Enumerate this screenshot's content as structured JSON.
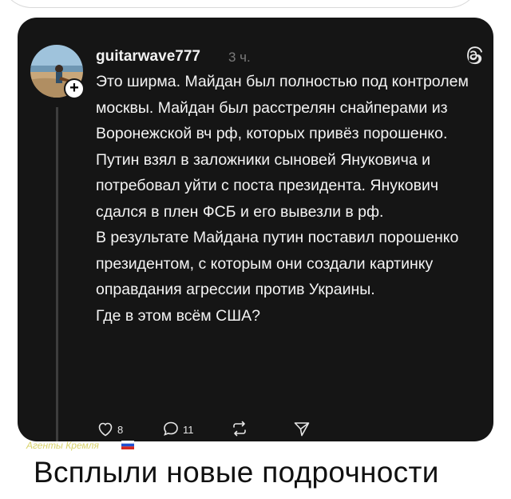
{
  "post": {
    "username": "guitarwave777",
    "time": "3 ч.",
    "paragraphs": [
      "Это ширма. Майдан был полностью под контролем москвы. Майдан был расстрелян снайперами из Воронежской вч рф, которых привёз порошенко. Путин взял в заложники сыновей Януковича и потребовал уйти с поста президента. Янукович сдался в плен ФСБ и его вывезли в рф.",
      "В результате Майдана путин поставил порошенко президентом, с которым они создали картинку оправдания агрессии против Украины.",
      "Где в этом всём США?"
    ],
    "actions": {
      "likes": "8",
      "comments": "11"
    }
  },
  "watermark": "Агенты Кремля",
  "caption": "Всплыли новые подрочности",
  "colors": {
    "card_bg": "#151515",
    "text": "#f4f4f4",
    "muted": "#7a7a7a",
    "watermark": "#d9d36a"
  }
}
